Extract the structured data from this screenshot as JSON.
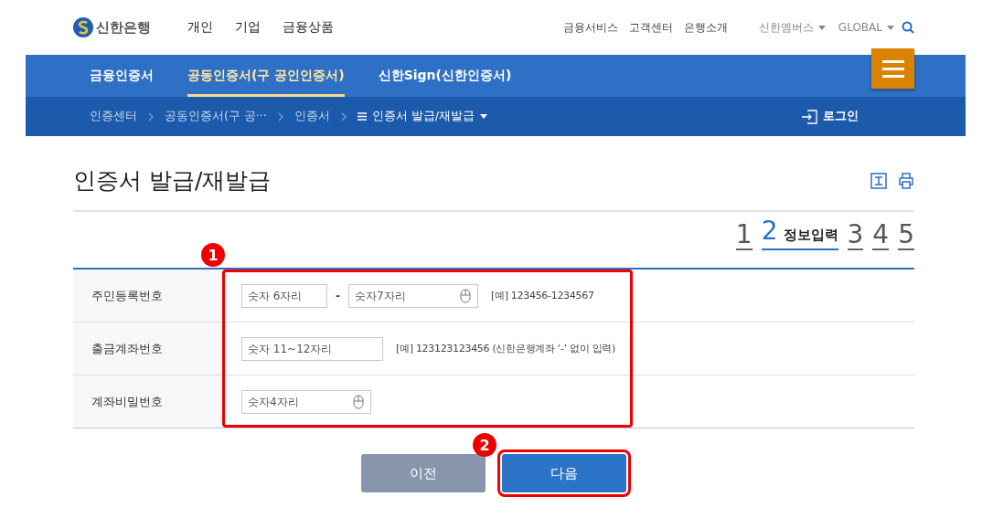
{
  "header": {
    "logo": "신한은행",
    "main_nav": [
      "개인",
      "기업",
      "금융상품"
    ],
    "util_nav": [
      "금융서비스",
      "고객센터",
      "은행소개"
    ],
    "dropdowns": [
      "신한멤버스",
      "GLOBAL"
    ]
  },
  "tabs": [
    {
      "label": "금융인증서",
      "selected": false
    },
    {
      "label": "공동인증서(구 공인인증서)",
      "selected": true
    },
    {
      "label": "신한Sign(신한인증서)",
      "selected": false
    }
  ],
  "breadcrumb": [
    "인증센터",
    "공동인증서(구 공···",
    "인증서",
    "인증서 발급/재발급"
  ],
  "login": "로그인",
  "title": "인증서 발급/재발급",
  "steps": [
    {
      "number": "1",
      "selected": false
    },
    {
      "number": "2",
      "label": "정보입력",
      "selected": true
    },
    {
      "number": "3",
      "selected": false
    },
    {
      "number": "4",
      "selected": false
    },
    {
      "number": "5",
      "selected": false
    }
  ],
  "form": [
    {
      "label": "주민등록번호",
      "fields": [
        {
          "placeholder": "숫자 6자리",
          "kind": "text"
        },
        {
          "placeholder": "숫자7자리",
          "kind": "secure"
        }
      ],
      "separator": "-",
      "hint": "[예] 123456-1234567"
    },
    {
      "label": "출금계좌번호",
      "fields": [
        {
          "placeholder": "숫자 11~12자리",
          "kind": "text"
        }
      ],
      "hint": "[예] 123123123456 (신한은행계좌 ‘-’ 없이 입력)"
    },
    {
      "label": "계좌비밀번호",
      "fields": [
        {
          "placeholder": "숫자4자리",
          "kind": "secure"
        }
      ]
    }
  ],
  "callouts": [
    "1",
    "2"
  ],
  "buttons": [
    {
      "label": "이전",
      "kind": "secondary",
      "highlighted": false
    },
    {
      "label": "다음",
      "kind": "primary",
      "highlighted": true
    }
  ]
}
